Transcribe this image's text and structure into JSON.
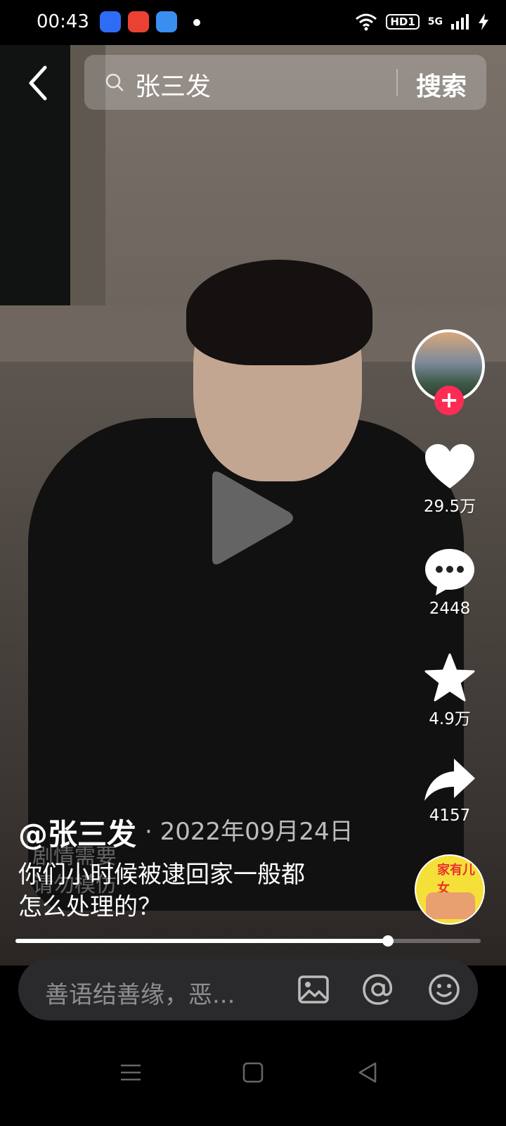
{
  "status_bar": {
    "time": "00:43",
    "hd_badge": "HD1",
    "network": "5G"
  },
  "search": {
    "query": "张三发",
    "button_label": "搜索"
  },
  "video": {
    "author": "@张三发",
    "date": "· 2022年09月24日",
    "caption_lines": [
      "你们小时候被逮回家一般都",
      "怎么处理的？"
    ],
    "watermark_lines": [
      "剧情需要",
      "请勿模仿"
    ],
    "progress": 0.8
  },
  "actions": {
    "likes": "29.5万",
    "comments": "2448",
    "favorites": "4.9万",
    "shares": "4157"
  },
  "music": {
    "disc_text": "家有儿女"
  },
  "comment_bar": {
    "placeholder": "善语结善缘，恶..."
  },
  "colors": {
    "follow_accent": "#fe2c55",
    "comment_bar_bg": "#2a2a2c"
  }
}
